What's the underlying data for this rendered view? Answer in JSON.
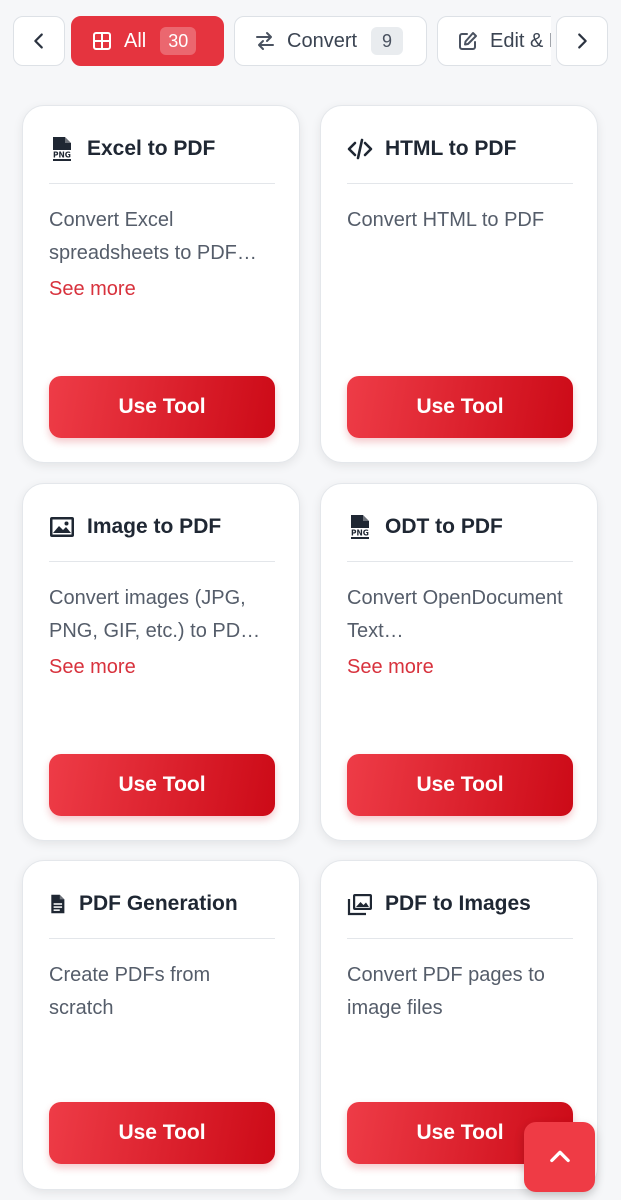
{
  "tabs": {
    "prev_icon": "chevron-left-icon",
    "next_icon": "chevron-right-icon",
    "items": [
      {
        "label": "All",
        "count": "30",
        "icon": "grid-icon",
        "active": true
      },
      {
        "label": "Convert",
        "count": "9",
        "icon": "swap-arrows-icon",
        "active": false
      },
      {
        "label": "Edit & M",
        "count": "",
        "icon": "edit-icon",
        "active": false
      }
    ]
  },
  "tools": [
    {
      "title": "Excel to PDF",
      "icon": "file-png-icon",
      "description": "Convert Excel spreadsheets to PDF…",
      "see_more": "See more",
      "button": "Use Tool"
    },
    {
      "title": "HTML to PDF",
      "icon": "code-icon",
      "description": "Convert HTML to PDF",
      "see_more": "",
      "button": "Use Tool"
    },
    {
      "title": "Image to PDF",
      "icon": "image-icon",
      "description": "Convert images (JPG, PNG, GIF, etc.) to PD…",
      "see_more": "See more",
      "button": "Use Tool"
    },
    {
      "title": "ODT to PDF",
      "icon": "file-png-icon",
      "description": "Convert OpenDocument Text…",
      "see_more": "See more",
      "button": "Use Tool"
    },
    {
      "title": "PDF Generation",
      "icon": "file-text-icon",
      "description": "Create PDFs from scratch",
      "see_more": "",
      "button": "Use Tool"
    },
    {
      "title": "PDF to Images",
      "icon": "images-icon",
      "description": "Convert PDF pages to image files",
      "see_more": "",
      "button": "Use Tool"
    }
  ],
  "scroll_top_icon": "chevron-up-icon",
  "colors": {
    "accent": "#e5343f",
    "button_gradient_start": "#ee3c47",
    "button_gradient_end": "#cc0a17",
    "link": "#d8323d",
    "background": "#f6f7f9"
  }
}
